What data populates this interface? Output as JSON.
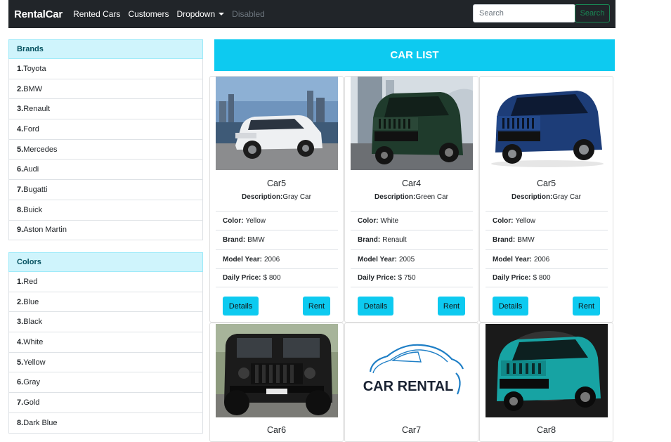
{
  "navbar": {
    "brand": "RentalCar",
    "links": [
      "Rented Cars",
      "Customers",
      "Dropdown",
      "Disabled"
    ],
    "search_placeholder": "Search",
    "search_button": "Search"
  },
  "brands": {
    "header": "Brands",
    "items": [
      {
        "num": "1.",
        "name": "Toyota"
      },
      {
        "num": "2.",
        "name": "BMW"
      },
      {
        "num": "3.",
        "name": "Renault"
      },
      {
        "num": "4.",
        "name": "Ford"
      },
      {
        "num": "5.",
        "name": "Mercedes"
      },
      {
        "num": "6.",
        "name": "Audi"
      },
      {
        "num": "7.",
        "name": "Bugatti"
      },
      {
        "num": "8.",
        "name": "Buick"
      },
      {
        "num": "9.",
        "name": "Aston Martin"
      }
    ]
  },
  "colors": {
    "header": "Colors",
    "items": [
      {
        "num": "1.",
        "name": "Red"
      },
      {
        "num": "2.",
        "name": "Blue"
      },
      {
        "num": "3.",
        "name": "Black"
      },
      {
        "num": "4.",
        "name": "White"
      },
      {
        "num": "5.",
        "name": "Yellow"
      },
      {
        "num": "6.",
        "name": "Gray"
      },
      {
        "num": "7.",
        "name": "Gold"
      },
      {
        "num": "8.",
        "name": "Dark Blue"
      }
    ]
  },
  "car_list": {
    "title": "CAR LIST",
    "labels": {
      "description": "Description:",
      "color": "Color:",
      "brand": "Brand:",
      "model_year": "Model Year:",
      "daily_price": "Daily Price:",
      "details_button": "Details",
      "rent_button": "Rent"
    },
    "cars": [
      {
        "name": "Car5",
        "description": "Gray Car",
        "color": "Yellow",
        "brand": "BMW",
        "model_year": "2006",
        "daily_price": "$ 800",
        "image": "white-suv"
      },
      {
        "name": "Car4",
        "description": "Green Car",
        "color": "White",
        "brand": "Renault",
        "model_year": "2005",
        "daily_price": "$ 750",
        "image": "green-suv"
      },
      {
        "name": "Car5",
        "description": "Gray Car",
        "color": "Yellow",
        "brand": "BMW",
        "model_year": "2006",
        "daily_price": "$ 800",
        "image": "blue-suv"
      },
      {
        "name": "Car6",
        "image": "black-jeep"
      },
      {
        "name": "Car7",
        "image": "car-rental-logo",
        "logo_text": "CAR RENTAL"
      },
      {
        "name": "Car8",
        "image": "teal-jeep"
      }
    ]
  }
}
